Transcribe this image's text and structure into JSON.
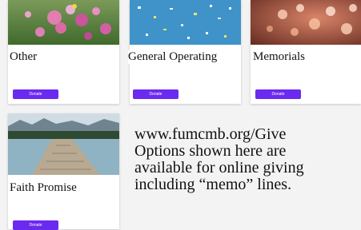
{
  "cards": [
    {
      "title": "Other",
      "image": "flower-field-photo",
      "button_label": "Donate"
    },
    {
      "title": "General Operating",
      "image": "confetti-blue-photo",
      "button_label": "Donate"
    },
    {
      "title": "Memorials",
      "image": "bokeh-hearts-photo",
      "button_label": "Donate"
    },
    {
      "title": "Faith Promise",
      "image": "lake-dock-photo",
      "button_label": "Donate"
    }
  ],
  "info": {
    "lines": [
      "www.fumcmb.org/Give",
      "Options shown here are",
      "available for online giving",
      "including “memo” lines."
    ]
  },
  "colors": {
    "button": "#6a2af0",
    "background": "#f3f3f3"
  }
}
